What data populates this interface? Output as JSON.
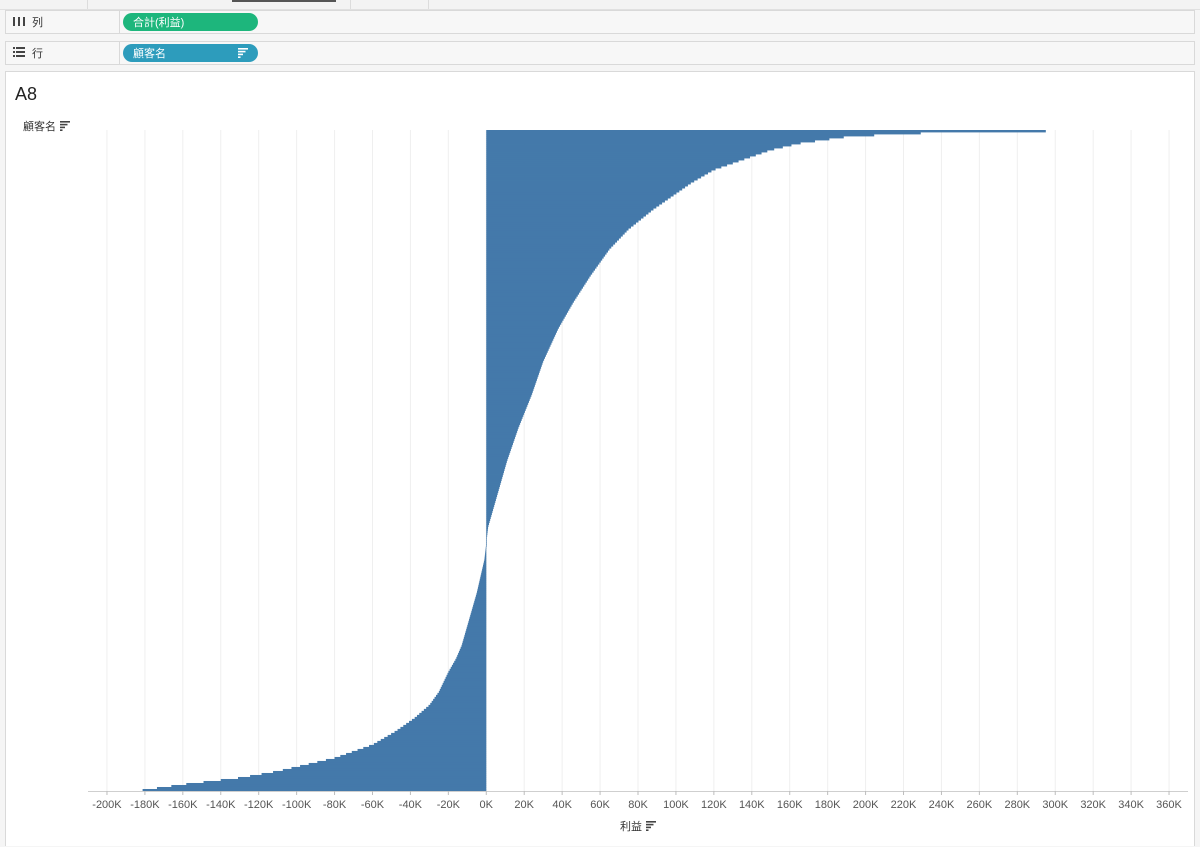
{
  "shelves": {
    "columns": {
      "icon": "columns-icon",
      "label": "列",
      "pill_label": "合計(利益)",
      "pill_color": "#1db67c"
    },
    "rows": {
      "icon": "rows-list-icon",
      "label": "行",
      "pill_label": "顧客名",
      "pill_color": "#2d9cbc"
    }
  },
  "sheet": {
    "title": "A8",
    "row_header": "顧客名",
    "sort_icon": "sort-descending-icon"
  },
  "chart_data": {
    "type": "bar",
    "orientation": "horizontal",
    "sorted": "descending",
    "bar_color": "#4479aa",
    "xlabel": "利益",
    "ylabel": "顧客名",
    "xlim": [
      -210000,
      370000
    ],
    "x_ticks": [
      -200000,
      -180000,
      -160000,
      -140000,
      -120000,
      -100000,
      -80000,
      -60000,
      -40000,
      -20000,
      0,
      20000,
      40000,
      60000,
      80000,
      100000,
      120000,
      140000,
      160000,
      180000,
      200000,
      220000,
      240000,
      260000,
      280000,
      300000,
      320000,
      340000,
      360000
    ],
    "x_tick_labels": [
      "-200K",
      "-180K",
      "-160K",
      "-140K",
      "-120K",
      "-100K",
      "-80K",
      "-60K",
      "-40K",
      "-20K",
      "0K",
      "20K",
      "40K",
      "60K",
      "80K",
      "100K",
      "120K",
      "140K",
      "160K",
      "180K",
      "200K",
      "220K",
      "240K",
      "260K",
      "280K",
      "300K",
      "320K",
      "340K",
      "360K"
    ],
    "grid": true,
    "profile": {
      "rank_fraction": [
        0,
        0.002,
        0.005,
        0.01,
        0.02,
        0.03,
        0.045,
        0.06,
        0.08,
        0.1,
        0.12,
        0.15,
        0.18,
        0.22,
        0.26,
        0.3,
        0.35,
        0.4,
        0.45,
        0.5,
        0.55,
        0.6,
        0.65,
        0.7,
        0.75,
        0.78,
        0.8,
        0.82,
        0.85,
        0.87,
        0.89,
        0.91,
        0.93,
        0.95,
        0.96,
        0.97,
        0.98,
        0.99,
        1
      ],
      "profit": [
        342000,
        280000,
        220000,
        190000,
        165000,
        150000,
        135000,
        120000,
        108000,
        98000,
        88000,
        75000,
        65000,
        55000,
        46000,
        38000,
        30000,
        24000,
        17000,
        11000,
        6000,
        1000,
        -1000,
        -5000,
        -10000,
        -13000,
        -16000,
        -20000,
        -25000,
        -30000,
        -38000,
        -48000,
        -60000,
        -80000,
        -95000,
        -110000,
        -130000,
        -160000,
        -185000
      ]
    }
  }
}
